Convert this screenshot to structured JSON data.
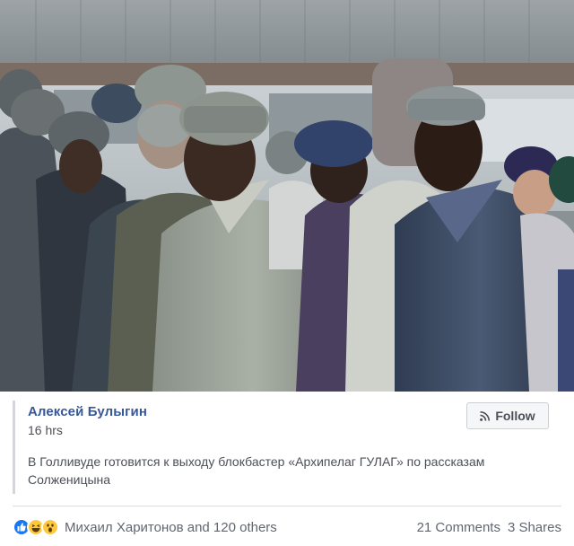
{
  "photo": {
    "alt_subject": "men in grey jackets and fur hats"
  },
  "shared_post": {
    "author": "Алексей Булыгин",
    "time": "16 hrs",
    "follow_label": "Follow",
    "text": "В Голливуде готовится к выходу блокбастер «Архипелаг ГУЛАГ» по рассказам Солженицына"
  },
  "footer": {
    "reaction_icons": [
      "like-icon",
      "haha-icon",
      "wow-icon"
    ],
    "reactors": "Михаил Харитонов and 120 others",
    "comments": "21 Comments",
    "shares": "3 Shares"
  },
  "colors": {
    "link_blue": "#365899",
    "like_blue": "#1877f2",
    "emoji_yellow": "#fcc93c",
    "muted_text": "#616770"
  }
}
